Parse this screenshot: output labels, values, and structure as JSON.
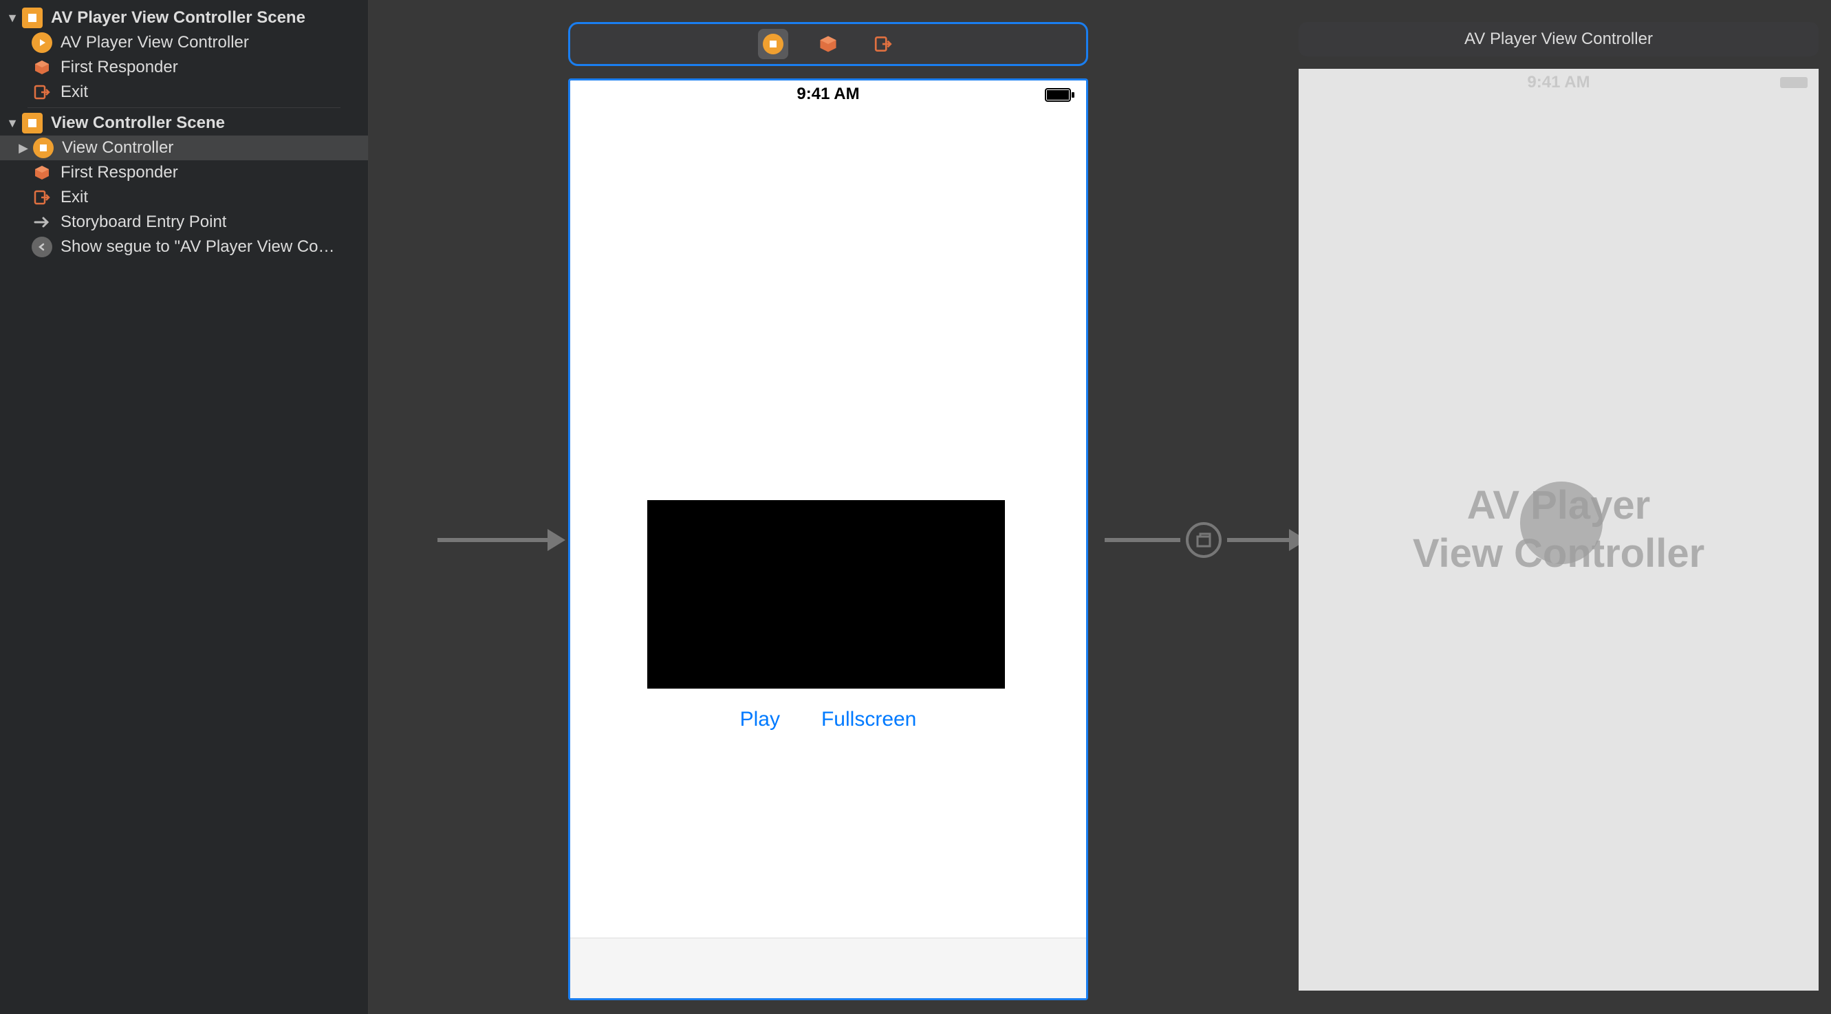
{
  "sidebar": {
    "scene1": {
      "title": "AV Player View Controller Scene",
      "items": [
        {
          "label": "AV Player View Controller"
        },
        {
          "label": "First Responder"
        },
        {
          "label": "Exit"
        }
      ]
    },
    "scene2": {
      "title": "View Controller Scene",
      "items": [
        {
          "label": "View Controller"
        },
        {
          "label": "First Responder"
        },
        {
          "label": "Exit"
        },
        {
          "label": "Storyboard Entry Point"
        },
        {
          "label": "Show segue to \"AV Player View Co…"
        }
      ]
    }
  },
  "canvas": {
    "phone1": {
      "status_time": "9:41 AM",
      "play_label": "Play",
      "fullscreen_label": "Fullscreen"
    },
    "phone2": {
      "title_bar": "AV Player View Controller",
      "status_time": "9:41 AM",
      "placeholder_line1": "AV Player",
      "placeholder_line2": "View Controller"
    }
  }
}
